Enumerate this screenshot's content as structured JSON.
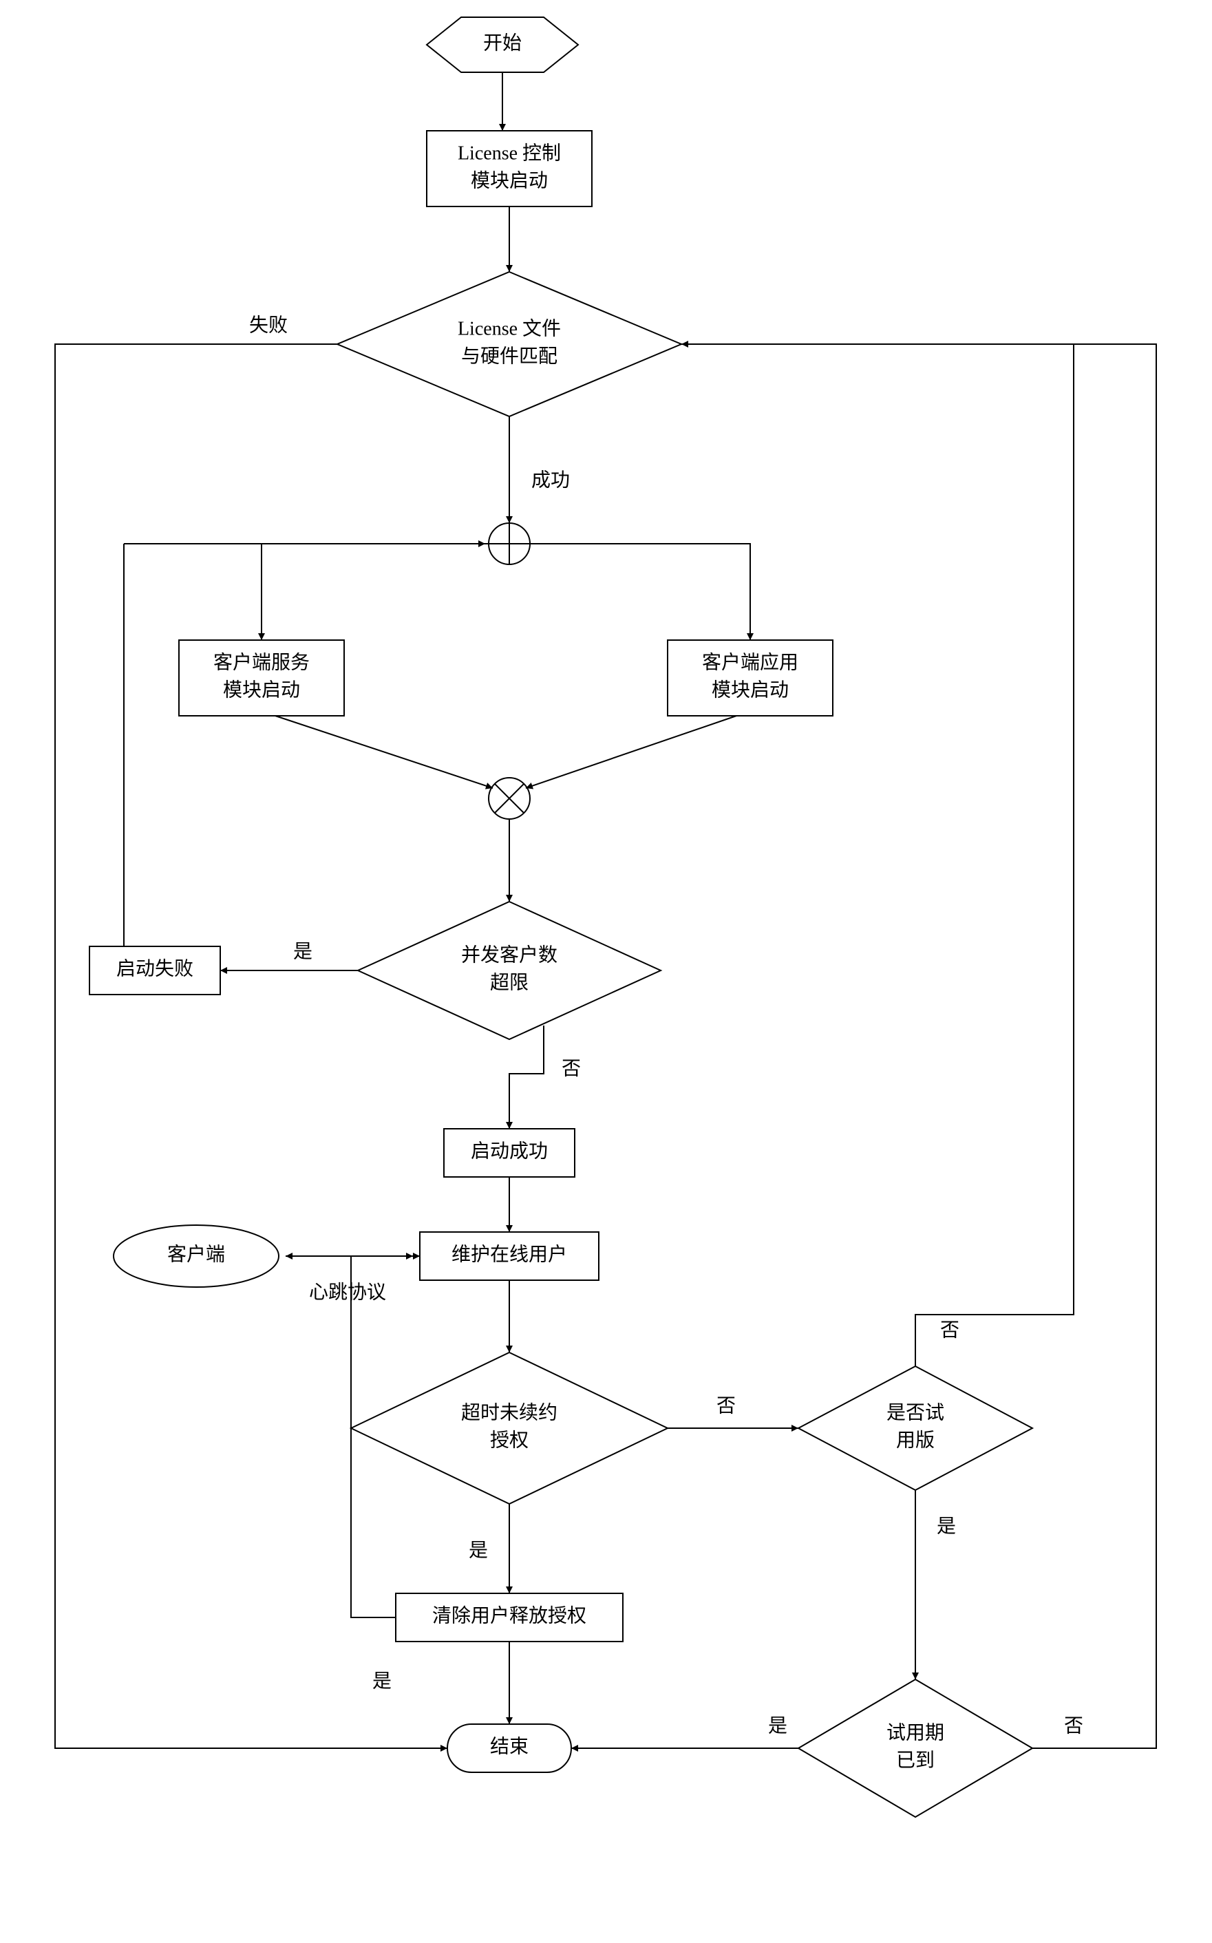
{
  "chart_data": {
    "type": "flowchart",
    "nodes": {
      "start": {
        "shape": "hexagon",
        "label": "开始"
      },
      "license_start": {
        "shape": "process",
        "label_lines": [
          "License 控制",
          "模块启动"
        ]
      },
      "match": {
        "shape": "decision",
        "label_lines": [
          "License 文件",
          "与硬件匹配"
        ]
      },
      "join_plus": {
        "shape": "circle_plus"
      },
      "client_service": {
        "shape": "process",
        "label_lines": [
          "客户端服务",
          "模块启动"
        ]
      },
      "client_app": {
        "shape": "process",
        "label_lines": [
          "客户端应用",
          "模块启动"
        ]
      },
      "join_x": {
        "shape": "circle_x"
      },
      "overlimit": {
        "shape": "decision",
        "label_lines": [
          "并发客户数",
          "超限"
        ]
      },
      "start_fail": {
        "shape": "process",
        "label": "启动失败"
      },
      "start_ok": {
        "shape": "process",
        "label": "启动成功"
      },
      "client": {
        "shape": "ellipse",
        "label": "客户端"
      },
      "maintain": {
        "shape": "process",
        "label": "维护在线用户"
      },
      "end_auth": {
        "shape": "decision",
        "label_lines": [
          "超时未续约",
          "授权"
        ]
      },
      "trial": {
        "shape": "decision",
        "label_lines": [
          "是否试",
          "用版"
        ]
      },
      "clear": {
        "shape": "process",
        "label": "清除用户释放授权"
      },
      "trial_due": {
        "shape": "decision",
        "label_lines": [
          "试用期",
          "已到"
        ]
      },
      "end": {
        "shape": "terminator",
        "label": "结束"
      }
    },
    "edges": [
      {
        "from": "start",
        "to": "license_start"
      },
      {
        "from": "license_start",
        "to": "match"
      },
      {
        "from": "match",
        "to": "join_plus",
        "label": "成功"
      },
      {
        "from": "match",
        "to": "end",
        "label": "失败",
        "via": "left-down"
      },
      {
        "from": "join_plus",
        "to": "client_service"
      },
      {
        "from": "join_plus",
        "to": "client_app"
      },
      {
        "from": "client_service",
        "to": "join_x"
      },
      {
        "from": "client_app",
        "to": "join_x"
      },
      {
        "from": "join_x",
        "to": "overlimit"
      },
      {
        "from": "overlimit",
        "to": "start_fail",
        "label": "是"
      },
      {
        "from": "start_fail",
        "to": "join_plus",
        "via": "left-up"
      },
      {
        "from": "overlimit",
        "to": "start_ok",
        "label": "否"
      },
      {
        "from": "start_ok",
        "to": "maintain"
      },
      {
        "from": "client",
        "to": "maintain",
        "label": "心跳协议",
        "bidir": true
      },
      {
        "from": "maintain",
        "to": "end_auth"
      },
      {
        "from": "end_auth",
        "to": "clear",
        "label": "是"
      },
      {
        "from": "end_auth",
        "to": "trial",
        "label": "否"
      },
      {
        "from": "trial",
        "to": "trial_due",
        "label": "是"
      },
      {
        "from": "trial",
        "to": "match",
        "label": "否",
        "via": "up-right"
      },
      {
        "from": "clear",
        "to": "end"
      },
      {
        "from": "clear",
        "to": "maintain",
        "label": "是",
        "via": "left-up"
      },
      {
        "from": "trial_due",
        "to": "end",
        "label": "是"
      },
      {
        "from": "trial_due",
        "to": "match",
        "label": "否",
        "via": "right-up"
      }
    ]
  },
  "labels": {
    "start": "开始",
    "license_start_1": "License 控制",
    "license_start_2": "模块启动",
    "match_1": "License 文件",
    "match_2": "与硬件匹配",
    "fail": "失败",
    "success": "成功",
    "client_service_1": "客户端服务",
    "client_service_2": "模块启动",
    "client_app_1": "客户端应用",
    "client_app_2": "模块启动",
    "overlimit_1": "并发客户数",
    "overlimit_2": "超限",
    "yes": "是",
    "no": "否",
    "start_fail": "启动失败",
    "start_ok": "启动成功",
    "client": "客户端",
    "heartbeat": "心跳协议",
    "maintain": "维护在线用户",
    "end_auth_1": "超时未续约",
    "end_auth_2": "授权",
    "trial_1": "是否试",
    "trial_2": "用版",
    "clear": "清除用户释放授权",
    "trial_due_1": "试用期",
    "trial_due_2": "已到",
    "end": "结束"
  }
}
